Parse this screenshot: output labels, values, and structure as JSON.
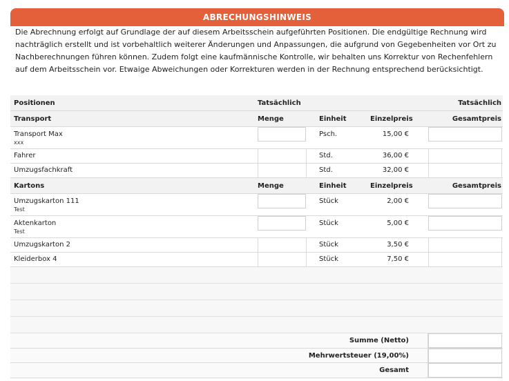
{
  "header": {
    "title": "ABRECHUNGSHINWEIS"
  },
  "notice": "Die Abrechnung erfolgt auf Grundlage der auf diesem Arbeitsschein aufgeführten Positionen. Die endgültige Rechnung wird nachträglich erstellt und ist vorbehaltlich weiterer Änderungen und Anpassungen, die aufgrund von Gegebenheiten vor Ort zu Nachberechnungen führen können. Zudem folgt eine kaufmännische Kontrolle, wir behalten uns Korrektur von Rechenfehlern auf dem Arbeitsschein vor. Etwaige Abweichungen oder Korrekturen werden in der Rechnung entsprechend berücksichtigt.",
  "table": {
    "top_header": {
      "positions": "Positionen",
      "actual_1": "Tatsächlich",
      "actual_2": "Tatsächlich"
    },
    "transport": {
      "title": "Transport",
      "qty": "Menge",
      "unit": "Einheit",
      "price": "Einzelpreis",
      "total": "Gesamtpreis",
      "items": [
        {
          "name": "Transport Max",
          "sub": "xxx",
          "unit": "Psch.",
          "price": "15,00 €"
        },
        {
          "name": "Fahrer",
          "unit": "Std.",
          "price": "36,00 €"
        },
        {
          "name": "Umzugsfachkraft",
          "unit": "Std.",
          "price": "32,00 €"
        }
      ]
    },
    "kartons": {
      "title": "Kartons",
      "qty": "Menge",
      "unit": "Einheit",
      "price": "Einzelpreis",
      "total": "Gesamtpreis",
      "items": [
        {
          "name": "Umzugskarton 111",
          "sub": "Test",
          "unit": "Stück",
          "price": "2,00 €"
        },
        {
          "name": "Aktenkarton",
          "sub": "Test",
          "unit": "Stück",
          "price": "5,00 €"
        },
        {
          "name": "Umzugskarton 2",
          "unit": "Stück",
          "price": "3,50 €"
        },
        {
          "name": "Kleiderbox 4",
          "unit": "Stück",
          "price": "7,50 €"
        }
      ]
    },
    "summary": {
      "net": "Summe (Netto)",
      "vat": "Mehrwertsteuer (19,00%)",
      "total": "Gesamt"
    }
  }
}
